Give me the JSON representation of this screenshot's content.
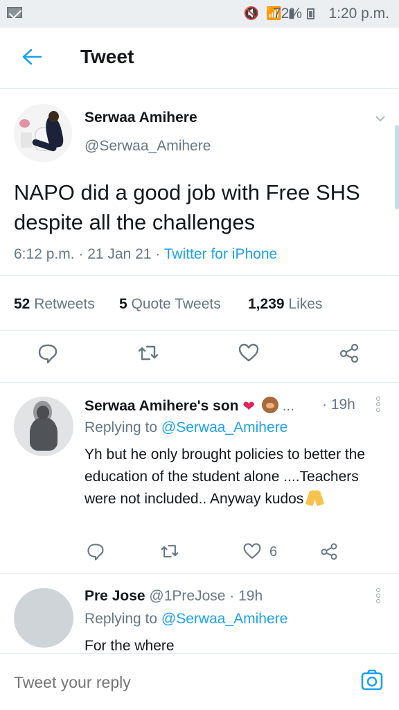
{
  "status_bar": {
    "battery_percent": "72%",
    "time": "1:20 p.m.",
    "icons": [
      "mail-icon",
      "mute-icon",
      "wifi-icon",
      "signal-icon",
      "battery-icon"
    ]
  },
  "header": {
    "title": "Tweet",
    "back_icon": "arrow-left-icon"
  },
  "tweet": {
    "author_name": "Serwaa Amihere",
    "author_handle": "@Serwaa_Amihere",
    "text": "NAPO did a good job with Free SHS despite all the challenges",
    "timestamp": "6:12 p.m. · 21 Jan 21",
    "separator": " · ",
    "source": "Twitter for iPhone",
    "stats": {
      "retweets_count": "52",
      "retweets_label": "Retweets",
      "quote_tweets_count": "5",
      "quote_tweets_label": "Quote Tweets",
      "likes_count": "1,239",
      "likes_label": "Likes"
    },
    "actions": [
      "reply-icon",
      "retweet-icon",
      "like-icon",
      "share-icon"
    ]
  },
  "replies": [
    {
      "author_name": "Serwaa Amihere's son",
      "emoji_suffix": "...",
      "time": "· 19h",
      "replying_to_label": "Replying to",
      "replying_to_handle": "@Serwaa_Amihere",
      "text": "Yh but he only brought policies to better the education of the student alone ....Teachers were not included.. Anyway kudos",
      "likes_count": "6",
      "colors": {
        "heart": "#e0245e",
        "prayer": "#f6c24b"
      }
    },
    {
      "author_name": "Pre Jose",
      "author_handle": "@1PreJose",
      "time": "· 19h",
      "replying_to_label": "Replying to",
      "replying_to_handle": "@Serwaa_Amihere",
      "text": "For the where"
    }
  ],
  "composer": {
    "placeholder": "Tweet your reply",
    "camera_icon": "camera-icon"
  },
  "colors": {
    "accent": "#1da1f2",
    "secondary_text": "#657786",
    "divider": "#e6ecf0"
  }
}
